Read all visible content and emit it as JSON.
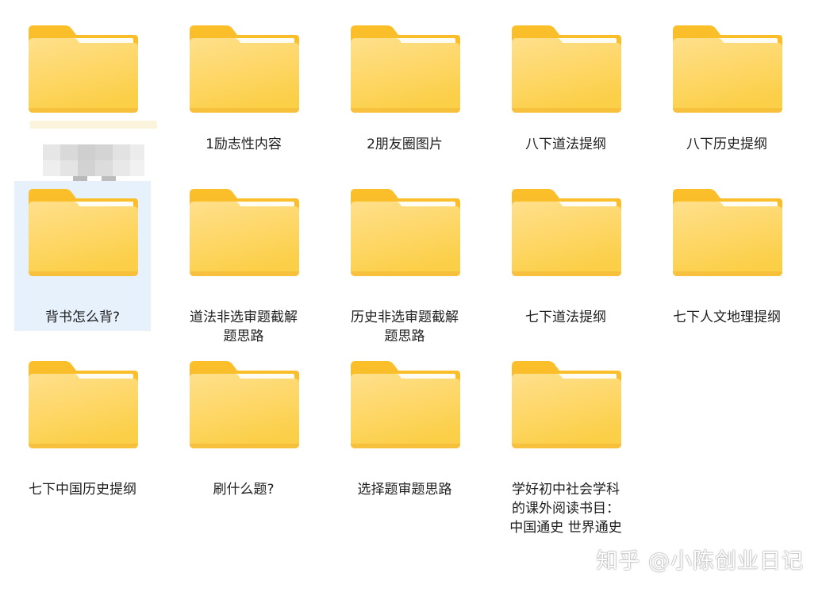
{
  "folders": [
    {
      "label": ""
    },
    {
      "label": "1励志性内容"
    },
    {
      "label": "2朋友圈图片"
    },
    {
      "label": "八下道法提纲"
    },
    {
      "label": "八下历史提纲"
    },
    {
      "label": "背书怎么背?"
    },
    {
      "label": "道法非选审题截解\n题思路"
    },
    {
      "label": "历史非选审题截解\n题思路"
    },
    {
      "label": "七下道法提纲"
    },
    {
      "label": "七下人文地理提纲"
    },
    {
      "label": "七下中国历史提纲"
    },
    {
      "label": "刷什么题?"
    },
    {
      "label": "选择题审题思路"
    },
    {
      "label": "学好初中社会学科\n的课外阅读书目：\n中国通史 世界通史"
    }
  ],
  "selected_index": 5,
  "watermark": "知乎 @小陈创业日记",
  "colors": {
    "folder_back": "#f5b928",
    "folder_front_top": "#ffe08c",
    "folder_front_bottom": "#fccf48",
    "paper": "#ffffff",
    "selection": "#e6f1fb"
  },
  "icons": {
    "folder": "folder-icon"
  }
}
